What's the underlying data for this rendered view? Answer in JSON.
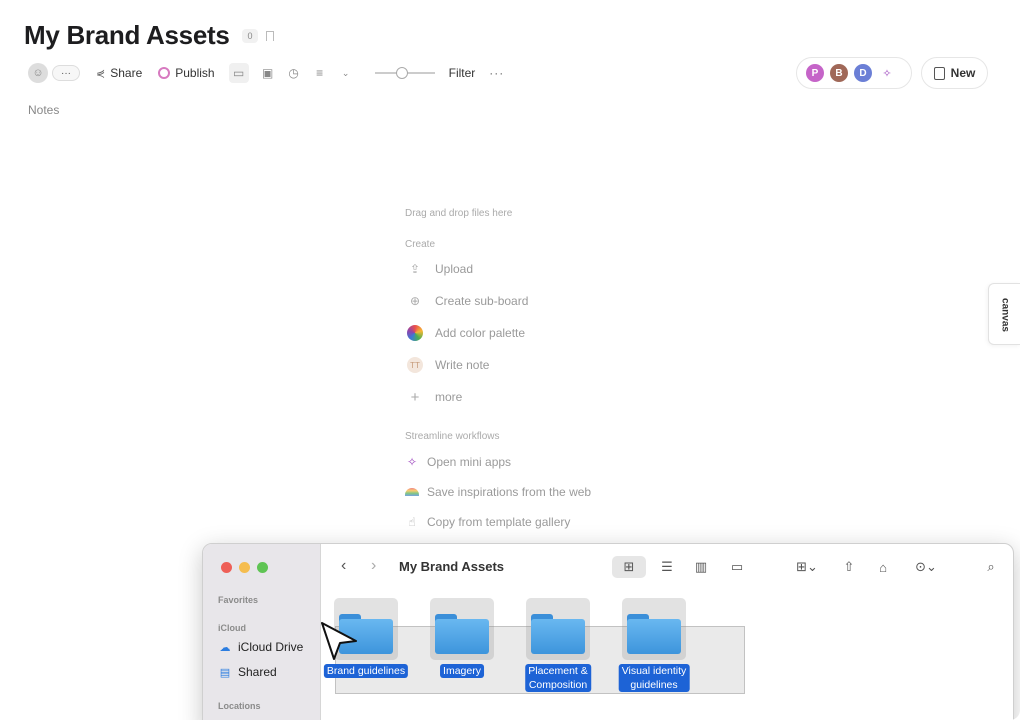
{
  "board": {
    "title": "My Brand Assets",
    "count": "0"
  },
  "toolbar": {
    "more_label": "···",
    "share_label": "Share",
    "publish_label": "Publish",
    "filter_label": "Filter",
    "dots_label": "···",
    "zoom_level": 0.45
  },
  "apps_cluster": {
    "items": [
      "P",
      "B",
      "D",
      "✧"
    ]
  },
  "new_button": {
    "label": "New"
  },
  "notes": {
    "label": "Notes"
  },
  "empty_panel": {
    "hint": "Drag and drop files here",
    "create_heading": "Create",
    "create_items": [
      "Upload",
      "Create sub-board",
      "Add color palette",
      "Write note",
      "more"
    ],
    "workflow_heading": "Streamline workflows",
    "workflow_items": [
      "Open mini apps",
      "Save inspirations from the web",
      "Copy from template gallery"
    ]
  },
  "canvas_tab": {
    "label": "canvas"
  },
  "finder": {
    "title": "My Brand Assets",
    "sidebar": {
      "favorites": "Favorites",
      "icloud": "iCloud",
      "icloud_drive": "iCloud Drive",
      "shared": "Shared",
      "locations": "Locations"
    },
    "folders": [
      {
        "label": "Brand guidelines"
      },
      {
        "label": "Imagery"
      },
      {
        "label": "Placement &\nComposition"
      },
      {
        "label": "Visual identity\nguidelines"
      }
    ]
  },
  "colors": {
    "selection_blue": "#1d63d6",
    "folder_blue": "#3d95dc",
    "traffic_red": "#ee5f57",
    "traffic_yellow": "#f5bd4f",
    "traffic_green": "#5fc454"
  }
}
